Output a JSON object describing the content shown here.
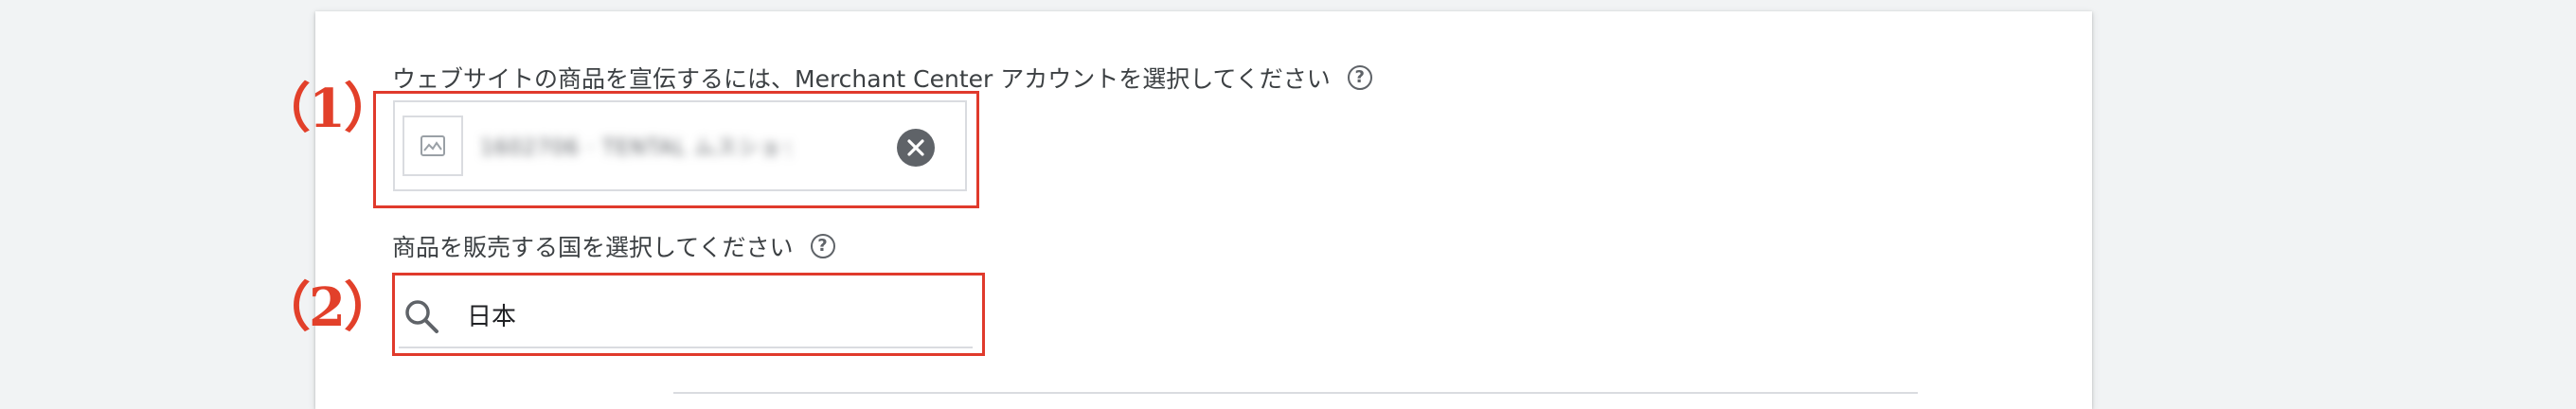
{
  "merchant_section": {
    "label": "ウェブサイトの商品を宣伝するには、Merchant Center アカウントを選択してください",
    "account_name": "1602706 · TENTAL ムスショップ",
    "help_icon": "help-circle-icon",
    "clear_icon": "close-circle-icon",
    "thumbnail_icon": "image-placeholder-icon"
  },
  "country_section": {
    "label": "商品を販売する国を選択してください",
    "help_icon": "help-circle-icon",
    "search_icon": "search-icon",
    "search_value": "日本"
  },
  "annotations": {
    "marker_1": "（1）",
    "marker_2": "（2）"
  },
  "colors": {
    "annotation_red": "#e03a2c",
    "text": "#3c4043",
    "icon_grey": "#5f6368",
    "border": "#dadce0"
  }
}
